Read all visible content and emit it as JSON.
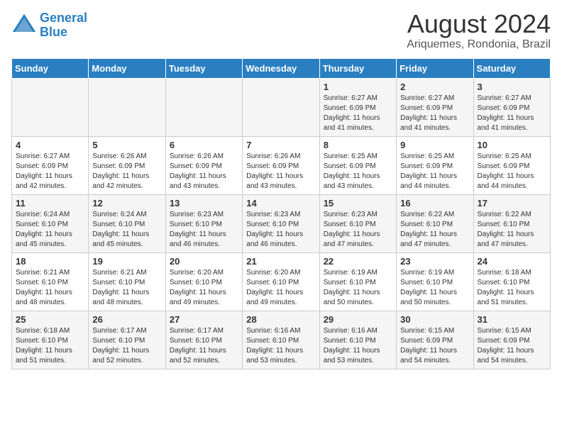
{
  "logo": {
    "line1": "General",
    "line2": "Blue"
  },
  "title": "August 2024",
  "location": "Ariquemes, Rondonia, Brazil",
  "days_header": [
    "Sunday",
    "Monday",
    "Tuesday",
    "Wednesday",
    "Thursday",
    "Friday",
    "Saturday"
  ],
  "weeks": [
    [
      {
        "day": "",
        "content": ""
      },
      {
        "day": "",
        "content": ""
      },
      {
        "day": "",
        "content": ""
      },
      {
        "day": "",
        "content": ""
      },
      {
        "day": "1",
        "content": "Sunrise: 6:27 AM\nSunset: 6:09 PM\nDaylight: 11 hours\nand 41 minutes."
      },
      {
        "day": "2",
        "content": "Sunrise: 6:27 AM\nSunset: 6:09 PM\nDaylight: 11 hours\nand 41 minutes."
      },
      {
        "day": "3",
        "content": "Sunrise: 6:27 AM\nSunset: 6:09 PM\nDaylight: 11 hours\nand 41 minutes."
      }
    ],
    [
      {
        "day": "4",
        "content": "Sunrise: 6:27 AM\nSunset: 6:09 PM\nDaylight: 11 hours\nand 42 minutes."
      },
      {
        "day": "5",
        "content": "Sunrise: 6:26 AM\nSunset: 6:09 PM\nDaylight: 11 hours\nand 42 minutes."
      },
      {
        "day": "6",
        "content": "Sunrise: 6:26 AM\nSunset: 6:09 PM\nDaylight: 11 hours\nand 43 minutes."
      },
      {
        "day": "7",
        "content": "Sunrise: 6:26 AM\nSunset: 6:09 PM\nDaylight: 11 hours\nand 43 minutes."
      },
      {
        "day": "8",
        "content": "Sunrise: 6:25 AM\nSunset: 6:09 PM\nDaylight: 11 hours\nand 43 minutes."
      },
      {
        "day": "9",
        "content": "Sunrise: 6:25 AM\nSunset: 6:09 PM\nDaylight: 11 hours\nand 44 minutes."
      },
      {
        "day": "10",
        "content": "Sunrise: 6:25 AM\nSunset: 6:09 PM\nDaylight: 11 hours\nand 44 minutes."
      }
    ],
    [
      {
        "day": "11",
        "content": "Sunrise: 6:24 AM\nSunset: 6:10 PM\nDaylight: 11 hours\nand 45 minutes."
      },
      {
        "day": "12",
        "content": "Sunrise: 6:24 AM\nSunset: 6:10 PM\nDaylight: 11 hours\nand 45 minutes."
      },
      {
        "day": "13",
        "content": "Sunrise: 6:23 AM\nSunset: 6:10 PM\nDaylight: 11 hours\nand 46 minutes."
      },
      {
        "day": "14",
        "content": "Sunrise: 6:23 AM\nSunset: 6:10 PM\nDaylight: 11 hours\nand 46 minutes."
      },
      {
        "day": "15",
        "content": "Sunrise: 6:23 AM\nSunset: 6:10 PM\nDaylight: 11 hours\nand 47 minutes."
      },
      {
        "day": "16",
        "content": "Sunrise: 6:22 AM\nSunset: 6:10 PM\nDaylight: 11 hours\nand 47 minutes."
      },
      {
        "day": "17",
        "content": "Sunrise: 6:22 AM\nSunset: 6:10 PM\nDaylight: 11 hours\nand 47 minutes."
      }
    ],
    [
      {
        "day": "18",
        "content": "Sunrise: 6:21 AM\nSunset: 6:10 PM\nDaylight: 11 hours\nand 48 minutes."
      },
      {
        "day": "19",
        "content": "Sunrise: 6:21 AM\nSunset: 6:10 PM\nDaylight: 11 hours\nand 48 minutes."
      },
      {
        "day": "20",
        "content": "Sunrise: 6:20 AM\nSunset: 6:10 PM\nDaylight: 11 hours\nand 49 minutes."
      },
      {
        "day": "21",
        "content": "Sunrise: 6:20 AM\nSunset: 6:10 PM\nDaylight: 11 hours\nand 49 minutes."
      },
      {
        "day": "22",
        "content": "Sunrise: 6:19 AM\nSunset: 6:10 PM\nDaylight: 11 hours\nand 50 minutes."
      },
      {
        "day": "23",
        "content": "Sunrise: 6:19 AM\nSunset: 6:10 PM\nDaylight: 11 hours\nand 50 minutes."
      },
      {
        "day": "24",
        "content": "Sunrise: 6:18 AM\nSunset: 6:10 PM\nDaylight: 11 hours\nand 51 minutes."
      }
    ],
    [
      {
        "day": "25",
        "content": "Sunrise: 6:18 AM\nSunset: 6:10 PM\nDaylight: 11 hours\nand 51 minutes."
      },
      {
        "day": "26",
        "content": "Sunrise: 6:17 AM\nSunset: 6:10 PM\nDaylight: 11 hours\nand 52 minutes."
      },
      {
        "day": "27",
        "content": "Sunrise: 6:17 AM\nSunset: 6:10 PM\nDaylight: 11 hours\nand 52 minutes."
      },
      {
        "day": "28",
        "content": "Sunrise: 6:16 AM\nSunset: 6:10 PM\nDaylight: 11 hours\nand 53 minutes."
      },
      {
        "day": "29",
        "content": "Sunrise: 6:16 AM\nSunset: 6:10 PM\nDaylight: 11 hours\nand 53 minutes."
      },
      {
        "day": "30",
        "content": "Sunrise: 6:15 AM\nSunset: 6:09 PM\nDaylight: 11 hours\nand 54 minutes."
      },
      {
        "day": "31",
        "content": "Sunrise: 6:15 AM\nSunset: 6:09 PM\nDaylight: 11 hours\nand 54 minutes."
      }
    ]
  ]
}
